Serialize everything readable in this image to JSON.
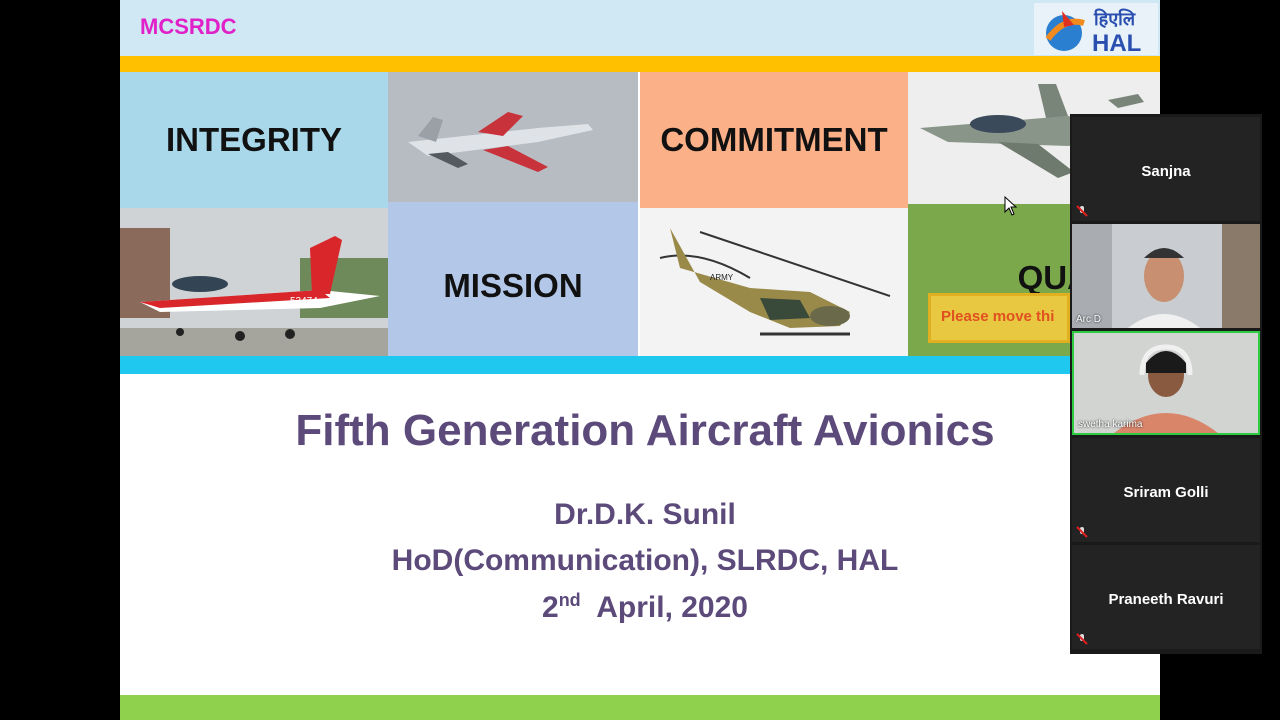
{
  "slide": {
    "brand": "MCSRDC",
    "logo_text": "हिएलि",
    "logo_brand": "HAL",
    "tiles": {
      "integrity": "INTEGRITY",
      "commitment": "COMMITMENT",
      "mission": "MISSION",
      "quality": "QUALIT"
    },
    "overlay_note": "Please move thi",
    "aircraft_tail": "53474",
    "helicopter_tail": "ARMY",
    "title": "Fifth Generation Aircraft Avionics",
    "author": "Dr.D.K. Sunil",
    "role": "HoD(Communication), SLRDC, HAL",
    "date_prefix": "2",
    "date_sup": "nd",
    "date_rest": "  April, 2020"
  },
  "participants": [
    {
      "name": "Sanjna",
      "video": false,
      "muted": true
    },
    {
      "name": "Arc D",
      "video": true,
      "muted": false
    },
    {
      "name": "swetha karima",
      "video": true,
      "muted": false
    },
    {
      "name": "Sriram Golli",
      "video": false,
      "muted": true
    },
    {
      "name": "Praneeth Ravuri",
      "video": false,
      "muted": true
    }
  ],
  "colors": {
    "brand": "#e020c8",
    "title": "#5b4a7a",
    "band_orange": "#ffc000",
    "band_cyan": "#1ec8ef",
    "band_green": "#8fd04c"
  }
}
